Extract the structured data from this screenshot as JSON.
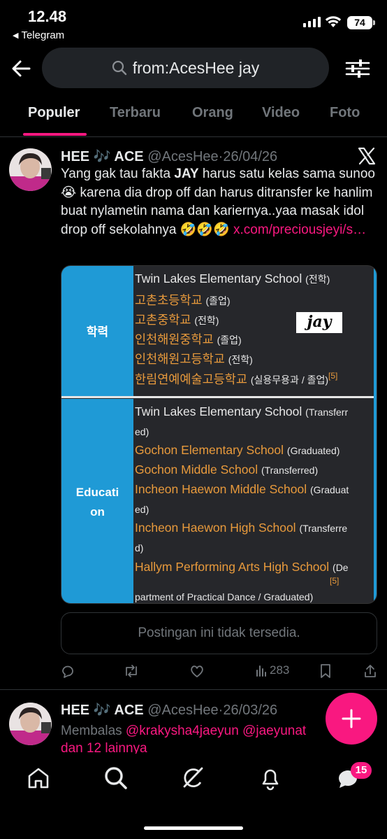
{
  "status_bar": {
    "time": "12.48",
    "back_app": "Telegram",
    "battery": "74"
  },
  "search": {
    "query": "from:AcesHee jay"
  },
  "tabs": [
    {
      "label": "Populer",
      "active": true
    },
    {
      "label": "Terbaru",
      "active": false
    },
    {
      "label": "Orang",
      "active": false
    },
    {
      "label": "Video",
      "active": false
    },
    {
      "label": "Foto",
      "active": false
    }
  ],
  "tweet1": {
    "name": "HEE 🎶 ACE",
    "handle": "@AcesHee",
    "dot": "·",
    "date": "26/04/26",
    "text_pre": "Yang gak tau fakta ",
    "text_bold": "JAY",
    "text_post": " harus satu kelas sama sunoo😭  karena dia drop off dan harus ditransfer ke hanlim buat nylametin nama dan kariernya..yaa masak idol drop off sekolahnya 🤣🤣🤣 ",
    "link": "x.com/preciousjeyi/s…",
    "media": {
      "label_top": "학력",
      "label_bottom_1": "Educati",
      "label_bottom_2": "on",
      "tag": "jay",
      "korean": [
        {
          "school": "Twin Lakes Elementary School",
          "note": "(전학)",
          "color": "white"
        },
        {
          "school": "고촌초등학교",
          "note": "(졸업)",
          "color": "orange"
        },
        {
          "school": "고촌중학교",
          "note": "(전학)",
          "color": "orange"
        },
        {
          "school": "인천해원중학교",
          "note": "(졸업)",
          "color": "orange"
        },
        {
          "school": "인천해원고등학교",
          "note": "(전학)",
          "color": "orange"
        },
        {
          "school": "한림연예예술고등학교",
          "note": "(실용무용과 / 졸업)",
          "sup": "[5]",
          "color": "orange"
        }
      ],
      "english": [
        {
          "school": "Twin Lakes Elementary School",
          "note": "(Transferr",
          "color": "white"
        },
        {
          "school": "",
          "note": "ed)",
          "color": "white"
        },
        {
          "school": "Gochon Elementary School",
          "note": "(Graduated)",
          "color": "orange"
        },
        {
          "school": "Gochon Middle School",
          "note": "(Transferred)",
          "color": "orange"
        },
        {
          "school": "Incheon Haewon Middle School",
          "note": "(Graduat",
          "color": "orange"
        },
        {
          "school": "",
          "note": "ed)",
          "color": "white"
        },
        {
          "school": "Incheon Haewon High School",
          "note": "(Transferre",
          "color": "orange"
        },
        {
          "school": "",
          "note": "d)",
          "color": "white"
        },
        {
          "school": "Hallym Performing Arts High School",
          "note": "(De",
          "color": "orange"
        },
        {
          "school": "",
          "note": "[5]",
          "color": "orange"
        },
        {
          "school": "",
          "note": "partment of Practical Dance / Graduated)",
          "color": "white"
        }
      ]
    },
    "unavailable": "Postingan ini tidak tersedia.",
    "views": "283"
  },
  "tweet2": {
    "name": "HEE 🎶 ACE",
    "handle": "@AcesHee",
    "dot": "·",
    "date": "26/03/26",
    "reply_prefix": "Membalas ",
    "reply_mentions": "@krakysha4jaeyun @jaeyunat",
    "reply_more": "dan 12 lainnya"
  },
  "bottom_nav": {
    "badge": "15"
  },
  "colors": {
    "accent": "#f91880",
    "background": "#000000",
    "muted": "#71767b",
    "media_blue": "#1f9ad6",
    "media_orange": "#e89a3c"
  }
}
